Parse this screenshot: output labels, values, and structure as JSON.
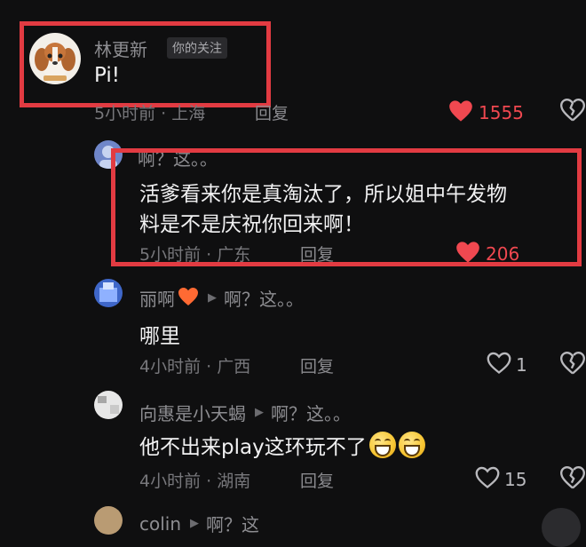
{
  "comments": [
    {
      "username": "林更新",
      "tag": "你的关注",
      "text": "Pi!",
      "meta": "5小时前 · 上海",
      "reply": "回复",
      "likes": "1555"
    },
    {
      "username": "啊？这。。",
      "text_line1": "活爹看来你是真淘汰了，所以姐中午发物",
      "text_line2": "料是不是庆祝你回来啊！",
      "meta": "5小时前 · 广东",
      "reply": "回复",
      "likes": "206"
    },
    {
      "username": "丽啊",
      "reply_to": "啊？这。。",
      "text": "哪里",
      "meta": "4小时前 · 广西",
      "reply": "回复",
      "likes": "1"
    },
    {
      "username": "向惠是小天蝎",
      "reply_to": "啊？这。。",
      "text": "他不出来play这环玩不了",
      "meta": "4小时前 · 湖南",
      "reply": "回复",
      "likes": "15"
    },
    {
      "username": "colin",
      "reply_to": "啊？这"
    }
  ],
  "icons": {
    "liked": "heart-filled-icon",
    "like": "heart-outline-icon",
    "dislike": "broken-heart-icon",
    "reply_arrow": "triangle-right-icon"
  },
  "colors": {
    "highlight": "#e23b42",
    "liked": "#f04850"
  }
}
